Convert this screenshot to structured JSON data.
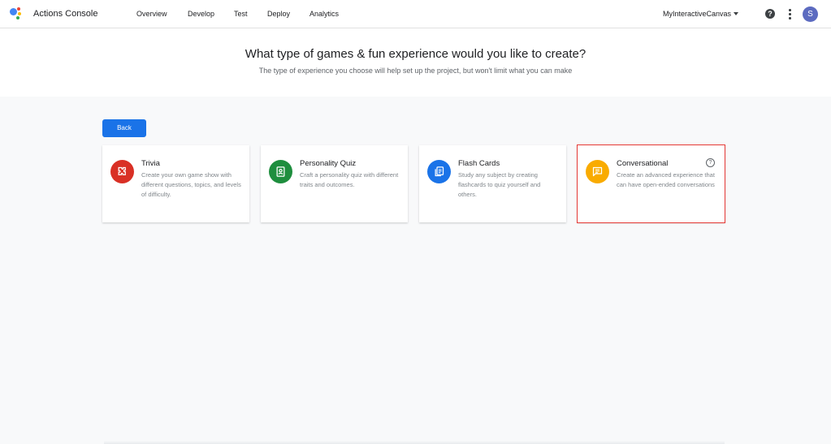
{
  "header": {
    "app_title": "Actions Console",
    "nav": [
      "Overview",
      "Develop",
      "Test",
      "Deploy",
      "Analytics"
    ],
    "project_name": "MyInteractiveCanvas",
    "help_glyph": "?",
    "avatar_letter": "S"
  },
  "hero": {
    "title": "What type of games & fun experience would you like to create?",
    "subtitle": "The type of experience you choose will help set up the project, but won't limit what you can make"
  },
  "back_label": "Back",
  "cards": [
    {
      "title": "Trivia",
      "desc": "Create your own game show with different questions, topics, and levels of difficulty.",
      "icon": "puzzle-icon",
      "color": "#d93025"
    },
    {
      "title": "Personality Quiz",
      "desc": "Craft a personality quiz with different traits and outcomes.",
      "icon": "contact-badge-icon",
      "color": "#1e8e3e"
    },
    {
      "title": "Flash Cards",
      "desc": "Study any subject by creating flashcards to quiz yourself and others.",
      "icon": "cards-icon",
      "color": "#1a73e8"
    },
    {
      "title": "Conversational",
      "desc": "Create an advanced experience that can have open-ended conversations",
      "icon": "chat-icon",
      "color": "#f9ab00",
      "info_glyph": "?"
    }
  ]
}
